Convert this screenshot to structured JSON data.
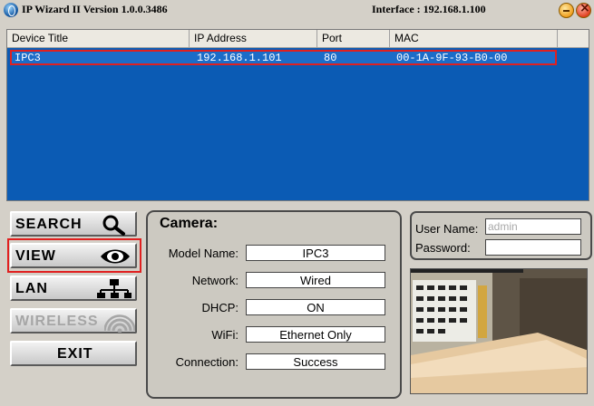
{
  "window": {
    "title": "IP Wizard II  Version 1.0.0.3486",
    "interface_text": "Interface : 192.168.1.100"
  },
  "device_list": {
    "columns": [
      "Device Title",
      "IP Address",
      "Port",
      "MAC"
    ],
    "rows": [
      {
        "title": "IPC3",
        "ip": "192.168.1.101",
        "port": "80",
        "mac": "00-1A-9F-93-B0-00"
      }
    ]
  },
  "sidebar": {
    "search_label": "SEARCH",
    "view_label": "VIEW",
    "lan_label": "LAN",
    "wireless_label": "WIRELESS",
    "exit_label": "EXIT"
  },
  "camera_panel": {
    "title": "Camera:",
    "fields": [
      {
        "label": "Model Name:",
        "value": "IPC3"
      },
      {
        "label": "Network:",
        "value": "Wired"
      },
      {
        "label": "DHCP:",
        "value": "ON"
      },
      {
        "label": "WiFi:",
        "value": "Ethernet Only"
      },
      {
        "label": "Connection:",
        "value": "Success"
      }
    ]
  },
  "login": {
    "user_label": "User Name:",
    "user_value": "admin",
    "password_label": "Password:",
    "password_value": ""
  },
  "colors": {
    "list_background": "#0b5bb4",
    "selected_row": "#1c6cc8",
    "highlight": "#e02020"
  },
  "icons": [
    "app-globe-icon",
    "minimize-icon",
    "close-icon",
    "magnifier-icon",
    "eye-icon",
    "network-icon",
    "wireless-icon"
  ]
}
